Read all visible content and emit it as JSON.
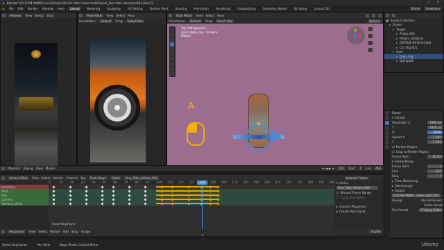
{
  "window": {
    "title": "Blender* [D:\\CAM ANIM\\Course\\Project\\04 On take movement\\Course_One take movement01.blend]"
  },
  "menu": [
    "File",
    "Edit",
    "Render",
    "Window",
    "Help"
  ],
  "workspaces": [
    "Layout",
    "Modeling",
    "Sculpting",
    "UV Editing",
    "Texture Paint",
    "Shading",
    "Animation",
    "Rendering",
    "Compositing",
    "Geometry Nodes",
    "Scripting",
    "Layout.001"
  ],
  "active_workspace": "Layout",
  "scene_field": "Scene",
  "viewlayer_field": "ViewLayer",
  "left_viewport": {
    "mode": "Preview",
    "menus": [
      "View",
      "Select",
      "Strip"
    ]
  },
  "mid_viewport": {
    "mode": "Pose Mode",
    "menus": [
      "View",
      "Select",
      "Pose"
    ],
    "sub": [
      "Orientation:",
      "Default",
      "Drag:",
      "Select Box"
    ]
  },
  "main_viewport": {
    "mode": "Pose Mode",
    "menus": [
      "View",
      "Select",
      "Pose"
    ],
    "sub": [
      "Orientation:",
      "Default",
      "Drag:",
      "Select Box"
    ],
    "options": "Options",
    "info_lines": [
      "Top Orthographic",
      "(142) Dolly_Rig : Camera",
      "Meters"
    ],
    "annotation": "A"
  },
  "outliner": {
    "title": "Scene Collection",
    "items": [
      {
        "label": "Scene",
        "depth": 1
      },
      {
        "label": "Target",
        "depth": 2
      },
      {
        "label": "Ambu.006",
        "depth": 3
      },
      {
        "label": "PROXY_VEHICLE",
        "depth": 3
      },
      {
        "label": "DATSUN B510 LH.002",
        "depth": 3
      },
      {
        "label": "Car_Rig.001",
        "depth": 3
      },
      {
        "label": "Cam",
        "depth": 2
      },
      {
        "label": "Dolly_Rig",
        "depth": 3,
        "selected": true
      },
      {
        "label": "Dollypath",
        "depth": 3
      }
    ]
  },
  "properties": {
    "scene_label": "Scene",
    "format_header": "Format",
    "rows": [
      {
        "label": "Resolution X",
        "value": "1080 px"
      },
      {
        "label": "Y",
        "value": "1920 px"
      },
      {
        "label": "%",
        "value": "100%",
        "blue": true
      },
      {
        "label": "Aspect X",
        "value": "1.000"
      },
      {
        "label": "Y",
        "value": "1.000"
      },
      {
        "label": "Render Region",
        "value": ""
      },
      {
        "label": "Crop to Render Region",
        "value": ""
      },
      {
        "label": "Frame Rate",
        "value": "30 fps"
      }
    ],
    "frame_range_header": "Frame Range",
    "frame_rows": [
      {
        "label": "Frame Start",
        "value": "1"
      },
      {
        "label": "End",
        "value": "450"
      },
      {
        "label": "Step",
        "value": "1"
      }
    ],
    "time_stretching": "Time Stretching",
    "stereoscopy": "Stereoscopy",
    "output_header": "Output",
    "output_path": "D:\\CAM ANIM\\...\\Inter_Fight.001",
    "saving_label": "Saving",
    "file_extensions": "File Extensions",
    "cache_result": "Cache Result",
    "file_format_label": "File Format",
    "file_format": "FFmpeg Video"
  },
  "timeline_header": {
    "items": [
      "Playback",
      "Keying",
      "View",
      "Marker"
    ],
    "current_frame": "142",
    "start": "Start",
    "start_val": "1",
    "end": "End",
    "end_val": "450"
  },
  "dopesheet_header": {
    "mode": "Action Editor",
    "menus": [
      "View",
      "Select",
      "Marker",
      "Channel",
      "Key"
    ],
    "push_down": "Push Down",
    "stash": "Stash",
    "action": "One_Take_Vehicle.001"
  },
  "channels": [
    {
      "label": "Summary",
      "color": "#8a3a3a"
    },
    {
      "label": "Root",
      "color": "#3a6a3a"
    },
    {
      "label": "Aim",
      "color": "#3a6a3a"
    },
    {
      "label": "Camera",
      "color": "#3a6a3a"
    },
    {
      "label": "Camera_offset",
      "color": "#3a6a3a"
    }
  ],
  "frame_ticks": [
    "0",
    "10",
    "20",
    "30",
    "40",
    "50",
    "60",
    "70",
    "80",
    "90",
    "100",
    "110",
    "120",
    "130",
    "140",
    "150",
    "160",
    "170",
    "180",
    "190",
    "200",
    "210",
    "220",
    "230",
    "240",
    "250",
    "260"
  ],
  "playhead_frame": "142",
  "markers": [
    "F_60",
    "F_142",
    "F_157",
    "F_188",
    "F_213",
    "F_230",
    "F_256"
  ],
  "insert_keyframe_label": "Insert Keyframe",
  "action_panel": {
    "tab": "Action",
    "action_name": "One_Take_Vehicle.001",
    "manual_frame_range": "Manual Frame Range",
    "cyclic_animation": "Cyclic Animation",
    "custom_properties": "Custom Properties",
    "create_pose_asset": "Create Pose Asset",
    "nearest_frame": "Nearest Frame"
  },
  "sequencer": {
    "label": "Sequencer",
    "menus": [
      "View",
      "Select",
      "Marker",
      "Add",
      "Strip",
      "Image"
    ]
  },
  "status": {
    "select": "Select Keyframes",
    "pan": "Pan View",
    "ctx": "Dope Sheet Context Menu",
    "shuffle": "Shuffle"
  },
  "watermark": "Udemy"
}
